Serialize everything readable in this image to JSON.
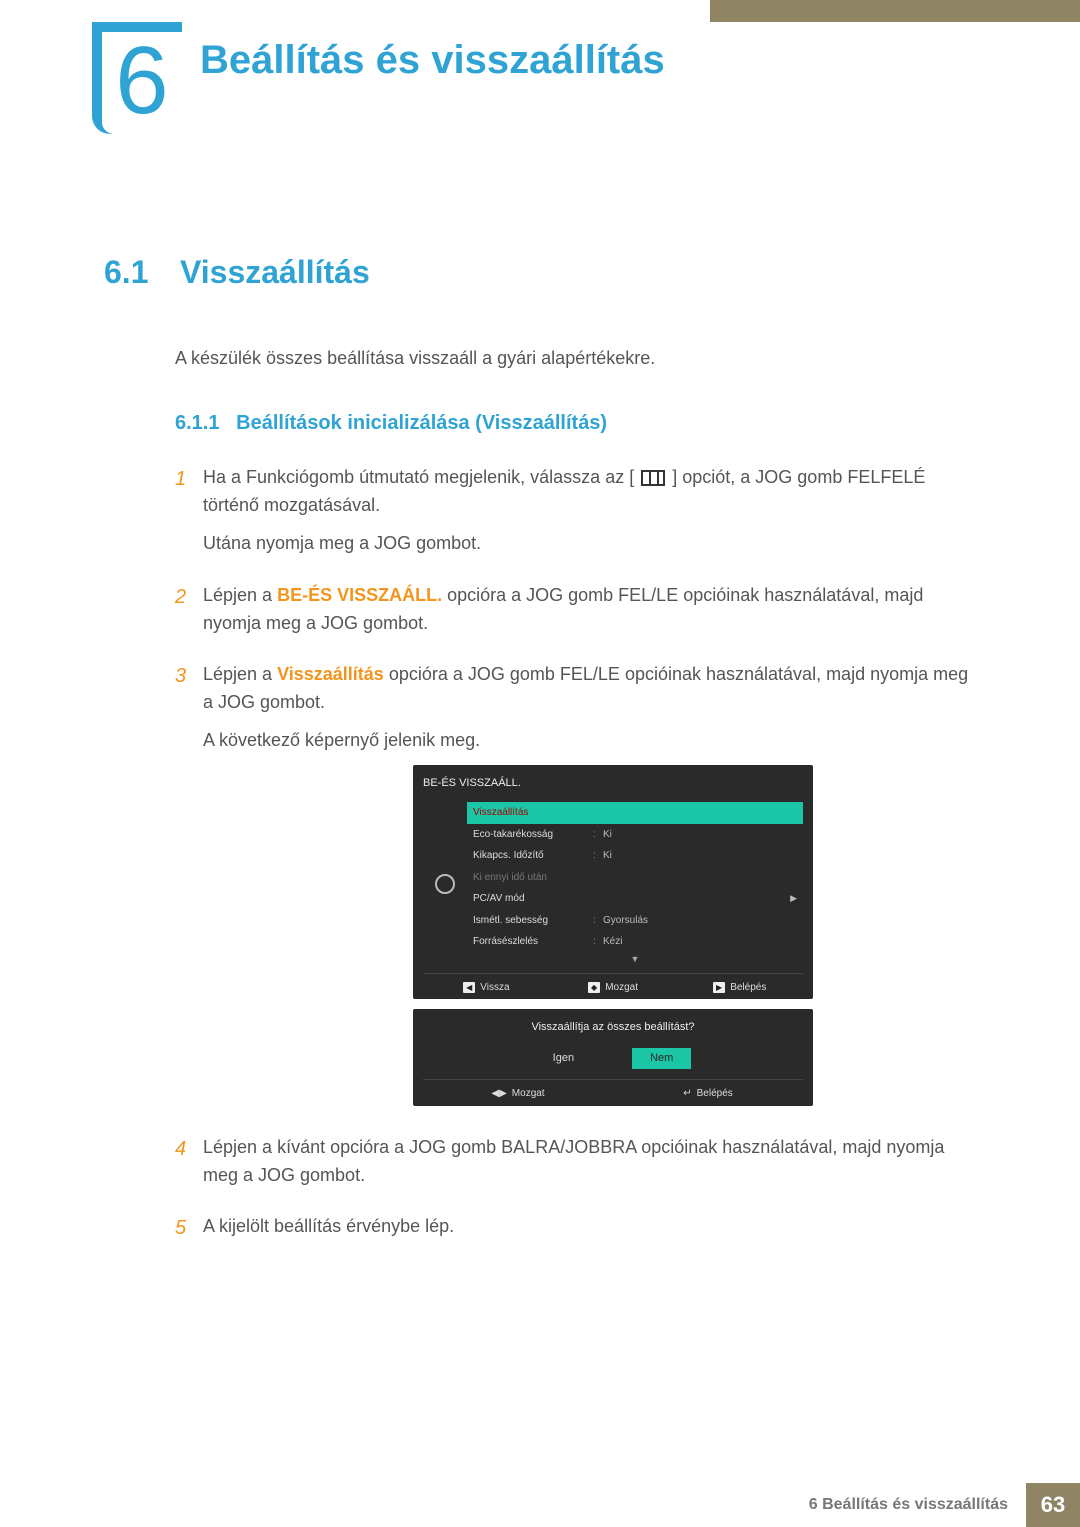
{
  "chapter": {
    "number": "6",
    "title": "Beállítás és visszaállítás"
  },
  "section": {
    "number": "6.1",
    "title": "Visszaállítás"
  },
  "intro": "A készülék összes beállítása visszaáll a gyári alapértékekre.",
  "subsection": {
    "number": "6.1.1",
    "title": "Beállítások inicializálása (Visszaállítás)"
  },
  "steps": {
    "s1a": "Ha a Funkciógomb útmutató megjelenik, válassza az [",
    "s1b": "] opciót, a JOG gomb FELFELÉ történő mozgatásával.",
    "s1c": "Utána nyomja meg a JOG gombot.",
    "s2a": "Lépjen a ",
    "s2b": "BE-ÉS VISSZAÁLL.",
    "s2c": " opcióra a JOG gomb FEL/LE opcióinak használatával, majd nyomja meg a JOG gombot.",
    "s3a": "Lépjen a ",
    "s3b": "Visszaállítás",
    "s3c": " opcióra a JOG gomb FEL/LE opcióinak használatával, majd nyomja meg a JOG gombot.",
    "s3d": "A következő képernyő jelenik meg.",
    "s4": "Lépjen a kívánt opcióra a JOG gomb BALRA/JOBBRA opcióinak használatával, majd nyomja meg a JOG gombot.",
    "s5": "A kijelölt beállítás érvénybe lép."
  },
  "step_nums": {
    "n1": "1",
    "n2": "2",
    "n3": "3",
    "n4": "4",
    "n5": "5"
  },
  "osd": {
    "title": "BE-ÉS VISSZAÁLL.",
    "rows": [
      {
        "label": "Visszaállítás",
        "value": ""
      },
      {
        "label": "Eco-takarékosság",
        "value": "Ki"
      },
      {
        "label": "Kikapcs. Időzítő",
        "value": "Ki"
      },
      {
        "label": "Ki ennyi idő után",
        "value": ""
      },
      {
        "label": "PC/AV mód",
        "value": ""
      },
      {
        "label": "Ismétl. sebesség",
        "value": "Gyorsulás"
      },
      {
        "label": "Forrásészlelés",
        "value": "Kézi"
      }
    ],
    "footer": {
      "back": "Vissza",
      "move": "Mozgat",
      "enter": "Belépés"
    }
  },
  "osd2": {
    "question": "Visszaállítja az összes beállítást?",
    "yes": "Igen",
    "no": "Nem",
    "footer": {
      "move": "Mozgat",
      "enter": "Belépés"
    }
  },
  "footer": {
    "text": "6 Beállítás és visszaállítás",
    "page": "63"
  }
}
